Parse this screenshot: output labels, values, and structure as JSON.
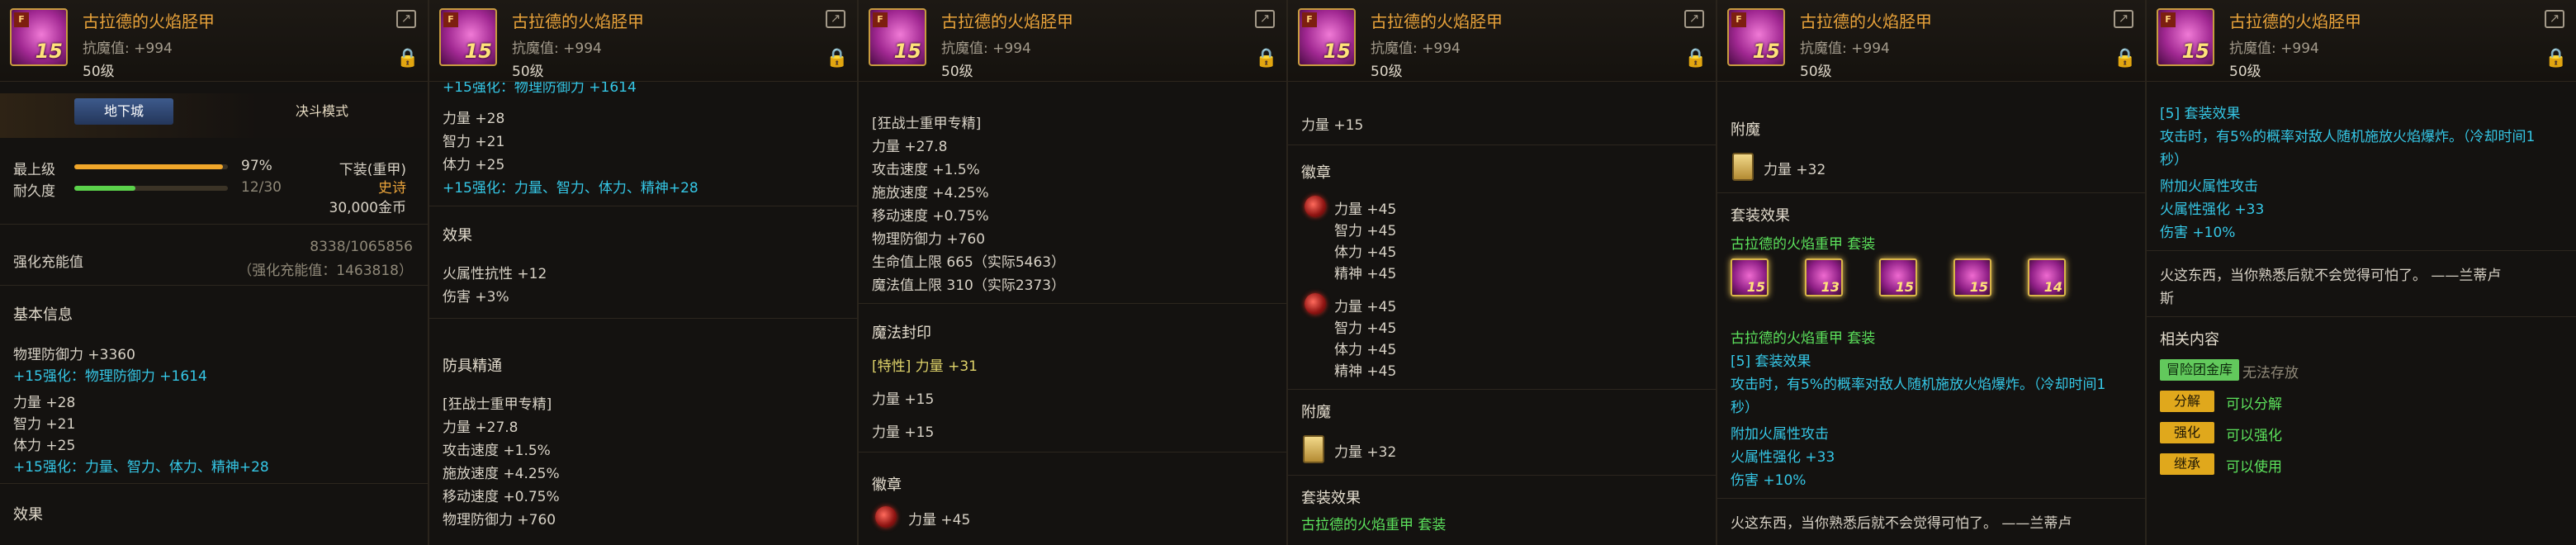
{
  "header": {
    "item_name": "古拉德的火焰胫甲",
    "resist_label": "抗魔值: +994",
    "level": "50级",
    "icon_badge": "F",
    "icon_level": "15"
  },
  "p1": {
    "tab_dungeon": "地下城",
    "tab_duel": "决斗模式",
    "max_level_label": "最上级",
    "max_level_pct": "97%",
    "max_level_value": 0.97,
    "durability_label": "耐久度",
    "durability_value": "12/30",
    "durability_fraction": 0.4,
    "equip_type": "下装(重甲)",
    "rarity": "史诗",
    "price": "30,000金币",
    "reinforce_label": "强化充能值",
    "reinforce_value": "8338/1065856",
    "reinforce_sub": "（强化充能值：1463818）",
    "basic_info": "基本信息",
    "phys_def": "物理防御力 +3360",
    "plus15_def": "+15强化：物理防御力 +1614",
    "str": "力量 +28",
    "int": "智力 +21",
    "vit": "体力 +25",
    "plus15_stats": "+15强化：力量、智力、体力、精神+28",
    "effect": "效果"
  },
  "p2": {
    "top_cut": "+15强化：物理防御力 +1614",
    "str": "力量 +28",
    "int": "智力 +21",
    "vit": "体力 +25",
    "plus15_stats": "+15强化：力量、智力、体力、精神+28",
    "effect": "效果",
    "fire_res": "火属性抗性 +12",
    "dmg": "伤害 +3%",
    "armor_mastery": "防具精通",
    "berserker": "[狂战士重甲专精]",
    "m_str": "力量 +27.8",
    "atk_speed": "攻击速度 +1.5%",
    "cast_speed": "施放速度 +4.25%",
    "move_speed": "移动速度 +0.75%",
    "phys_def": "物理防御力 +760"
  },
  "p3": {
    "berserker": "[狂战士重甲专精]",
    "m_str": "力量 +27.8",
    "atk_speed": "攻击速度 +1.5%",
    "cast_speed": "施放速度 +4.25%",
    "move_speed": "移动速度 +0.75%",
    "phys_def": "物理防御力 +760",
    "hp": "生命值上限 665（实际5463）",
    "mp": "魔法值上限 310（实际2373）",
    "magic_seal": "魔法封印",
    "trait": "[特性] 力量 +31",
    "str1": "力量 +15",
    "str2": "力量 +15",
    "emblem": "徽章",
    "emblem_str": "力量 +45"
  },
  "p4": {
    "top_str": "力量 +15",
    "emblem": "徽章",
    "e_str": "力量 +45",
    "e_int": "智力 +45",
    "e_vit": "体力 +45",
    "e_spi": "精神 +45",
    "enchant": "附魔",
    "enchant_str": "力量 +32",
    "set_effect": "套装效果",
    "set_name": "古拉德的火焰重甲 套装"
  },
  "p5": {
    "enchant": "附魔",
    "enchant_str": "力量 +32",
    "set_effect": "套装效果",
    "set_name": "古拉德的火焰重甲 套装",
    "set_name2": "古拉德的火焰重甲 套装",
    "set_count": "[5] 套装效果",
    "desc1": "攻击时，有5%的概率对敌人随机施放火焰爆炸。（冷却时间1",
    "desc2": "秒）",
    "extra": "附加火属性攻击",
    "fire": "火属性强化 +33",
    "dmg": "伤害 +10%",
    "flavor": "火这东西，当你熟悉后就不会觉得可怕了。 ——兰蒂卢",
    "set_levels": [
      "15",
      "13",
      "15",
      "15",
      "14"
    ]
  },
  "p6": {
    "set_count": "[5] 套装效果",
    "desc1": "攻击时，有5%的概率对敌人随机施放火焰爆炸。（冷却时间1",
    "desc2": "秒）",
    "extra": "附加火属性攻击",
    "fire": "火属性强化 +33",
    "dmg": "伤害 +10%",
    "flavor1": "火这东西，当你熟悉后就不会觉得可怕了。 ——兰蒂卢",
    "flavor2": "斯",
    "related": "相关内容",
    "vault_tag": "冒险团金库",
    "vault_text": "无法存放",
    "decompose_tag": "分解",
    "decompose_text": "可以分解",
    "enhance_tag": "强化",
    "enhance_text": "可以强化",
    "inherit_tag": "继承",
    "inherit_text": "可以使用"
  }
}
